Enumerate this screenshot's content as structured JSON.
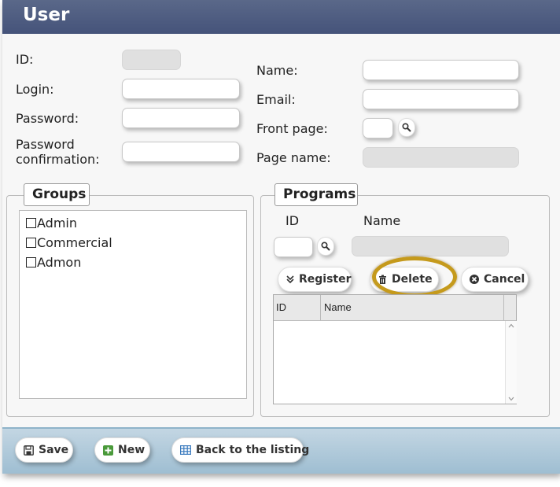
{
  "window": {
    "title": "User"
  },
  "form": {
    "id_label": "ID:",
    "login_label": "Login:",
    "password_label": "Password:",
    "password_confirmation_label_line1": "Password",
    "password_confirmation_label_line2": "confirmation:",
    "name_label": "Name:",
    "email_label": "Email:",
    "front_page_label": "Front page:",
    "page_name_label": "Page name:",
    "id_value": "",
    "login_value": "",
    "password_value": "",
    "password_confirmation_value": "",
    "name_value": "",
    "email_value": "",
    "front_page_value": "",
    "page_name_value": ""
  },
  "groups": {
    "legend": "Groups",
    "items": [
      {
        "label": "Admin",
        "checked": false
      },
      {
        "label": "Commercial",
        "checked": false
      },
      {
        "label": "Admon",
        "checked": false
      }
    ]
  },
  "programs": {
    "legend": "Programs",
    "id_header": "ID",
    "name_header": "Name",
    "id_value": "",
    "name_value": "",
    "register_label": "Register",
    "delete_label": "Delete",
    "cancel_label": "Cancel",
    "grid": {
      "columns": [
        "ID",
        "Name"
      ],
      "rows": []
    }
  },
  "footer": {
    "save_label": "Save",
    "new_label": "New",
    "back_label": "Back to the listing"
  },
  "colors": {
    "titlebar": "#4a5880",
    "footer": "#a9c6d8",
    "highlight_ring": "#c59a1c",
    "new_icon": "#4a9a3a",
    "listing_icon": "#3b7bbf"
  },
  "icons": {
    "search": "magnifier-icon",
    "register": "double-chevron-down-icon",
    "delete": "trash-icon",
    "cancel": "x-circle-icon",
    "save": "floppy-disk-icon",
    "new": "plus-square-icon",
    "back": "table-grid-icon"
  }
}
